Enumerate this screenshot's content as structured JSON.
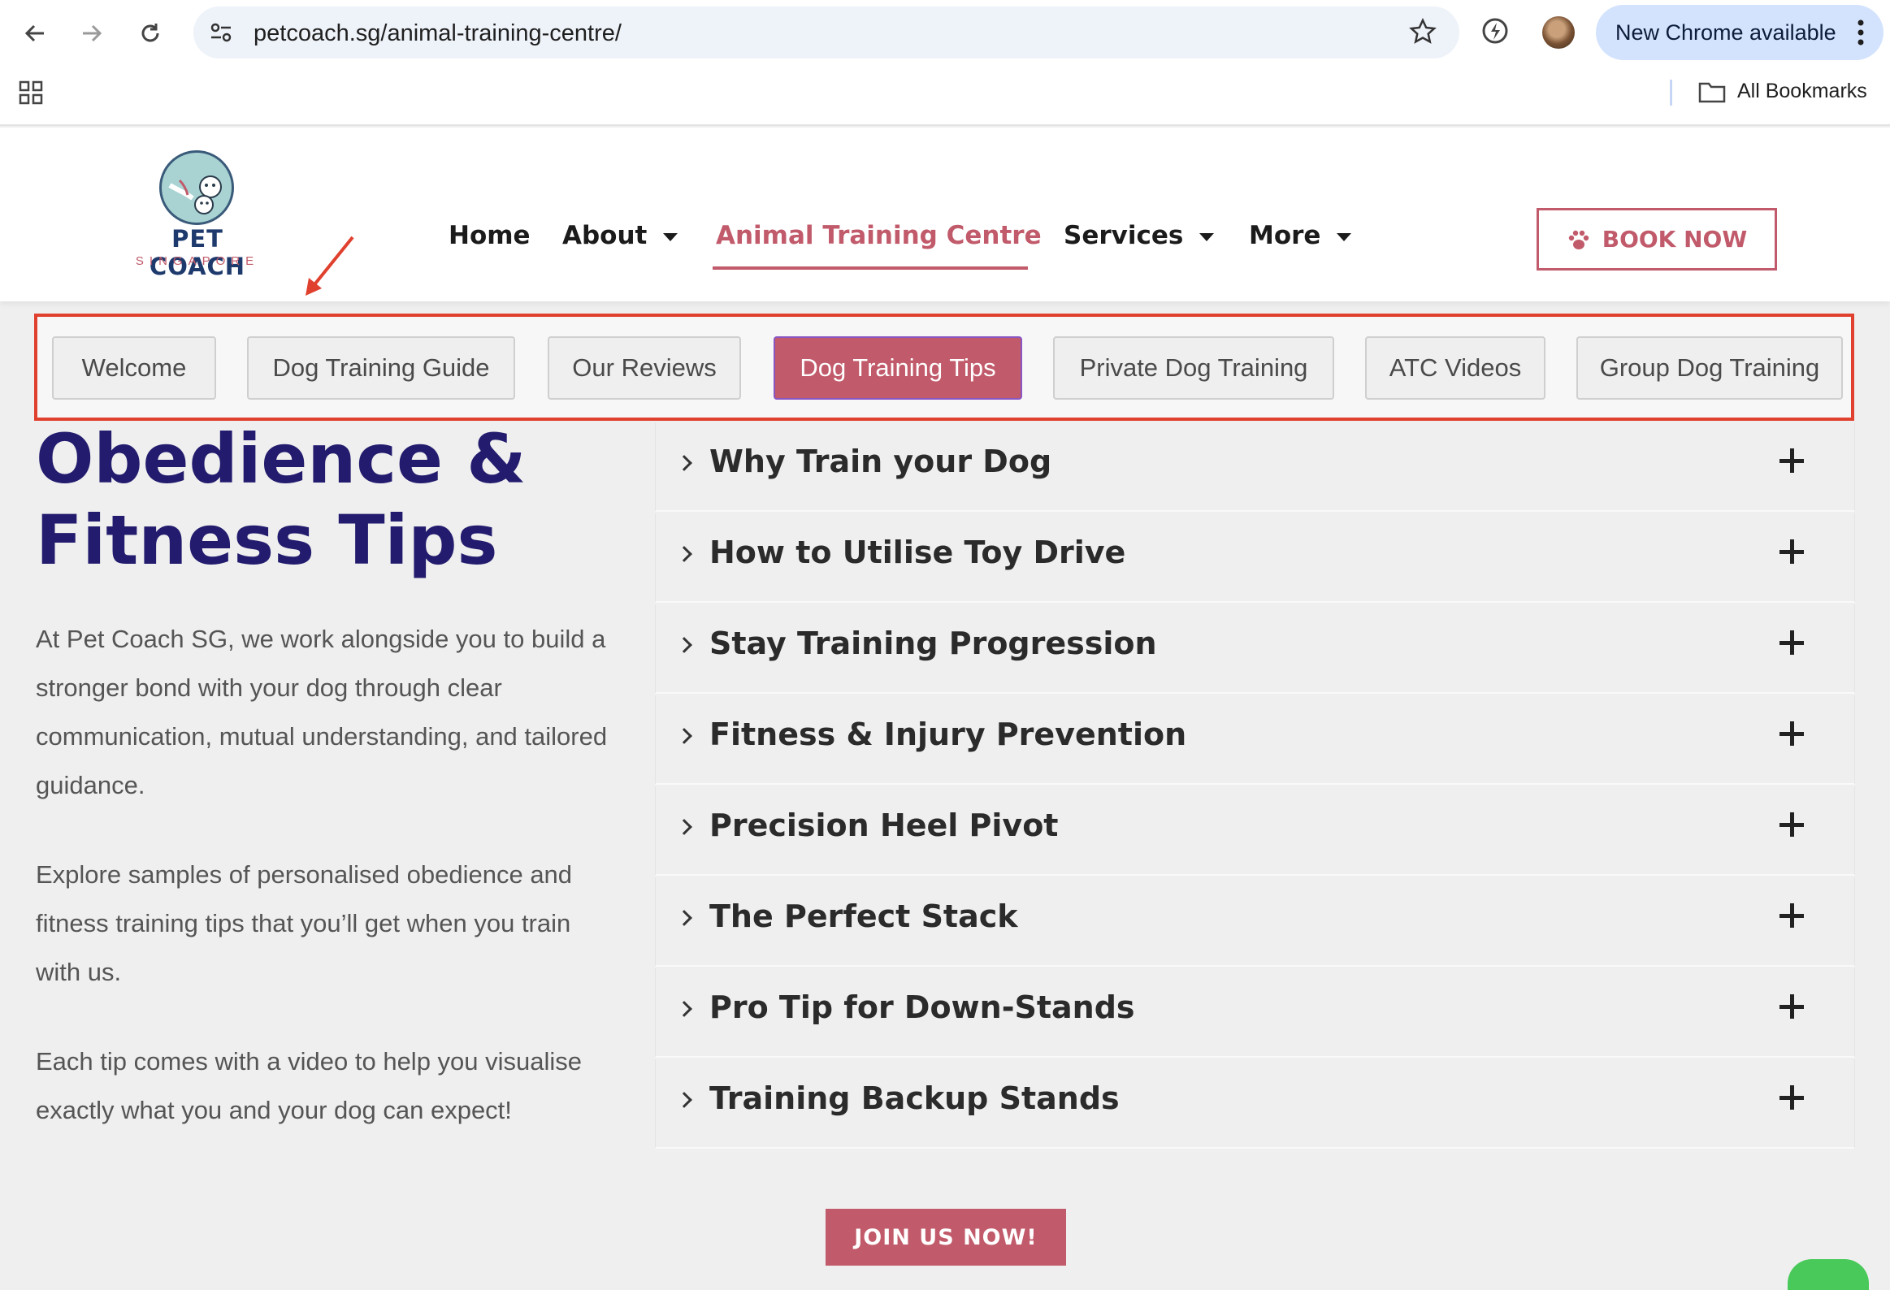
{
  "browser": {
    "url_host": "petcoach.sg",
    "url_path": "/animal-training-centre/",
    "update_label": "New Chrome available",
    "bookmarks_label": "All Bookmarks"
  },
  "logo": {
    "name": "PET COACH",
    "sub": "SINGAPORE"
  },
  "nav": {
    "home": "Home",
    "about": "About",
    "atc": "Animal Training Centre",
    "services": "Services",
    "more": "More",
    "book_now": "BOOK NOW"
  },
  "tabs": [
    "Welcome",
    "Dog Training Guide",
    "Our Reviews",
    "Dog Training Tips",
    "Private Dog Training",
    "ATC Videos",
    "Group Dog Training"
  ],
  "active_tab": "Dog Training Tips",
  "title_line1": "Obedience &",
  "title_line2": "Fitness Tips",
  "paragraphs": [
    "At Pet Coach SG, we work alongside you to build a stronger bond with your dog through clear communication, mutual understanding, and tailored guidance.",
    "Explore samples of personalised obedience and fitness training tips that you’ll get when you train with us.",
    "Each tip comes with a video to help you visualise exactly what you and your dog can expect!"
  ],
  "accordion": [
    "Why Train your Dog",
    "How to Utilise Toy Drive",
    "Stay Training Progression",
    "Fitness & Injury Prevention",
    "Precision Heel Pivot",
    "The Perfect Stack",
    "Pro Tip for Down-Stands",
    "Training Backup Stands"
  ],
  "join_label": "JOIN US NOW!",
  "colors": {
    "brand_rose": "#c15a6a",
    "title_navy": "#231c6e",
    "annotation_red": "#e0402e"
  }
}
